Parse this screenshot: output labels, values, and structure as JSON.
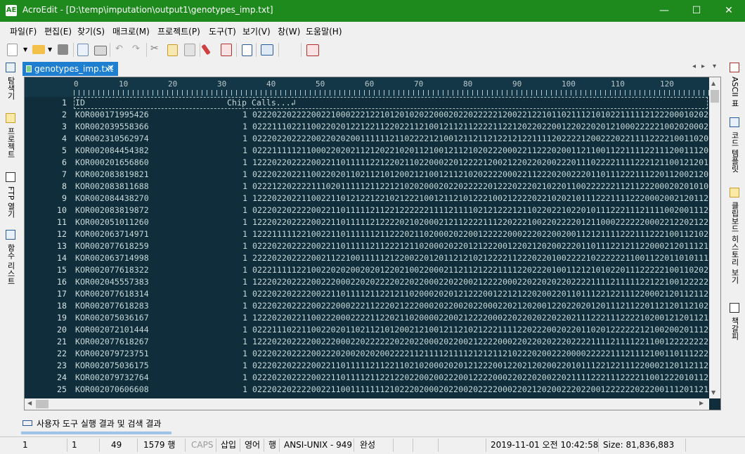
{
  "window": {
    "app_icon": "AE",
    "title": "AcroEdit - [D:\\temp\\imputation\\output1\\genotypes_imp.txt]",
    "minimize": "—",
    "maximize": "☐",
    "close": "✕"
  },
  "menu": [
    "파일(F)",
    "편집(E)",
    "찾기(S)",
    "매크로(M)",
    "프로젝트(P)",
    "도구(T)",
    "보기(V)",
    "창(W)",
    "도움말(H)"
  ],
  "left_panels": [
    {
      "label": "탐색기",
      "icon": "explorer-icon"
    },
    {
      "label": "프로젝트",
      "icon": "project-icon"
    },
    {
      "label": "FTP 열기",
      "icon": "ftp-icon"
    },
    {
      "label": "함수 리스트",
      "icon": "function-list-icon"
    }
  ],
  "right_panels": [
    {
      "label": "ASCII 표",
      "icon": "ascii-table-icon"
    },
    {
      "label": "코드 템플릿",
      "icon": "code-template-icon"
    },
    {
      "label": "클립보드 히스토리 보기",
      "icon": "clipboard-history-icon"
    },
    {
      "label": "책갈피",
      "icon": "bookmark-icon"
    }
  ],
  "tab": {
    "name": "genotypes_imp.txt",
    "close": "✕"
  },
  "tab_nav": {
    "prev": "◂",
    "next": "▸",
    "menu": "▾"
  },
  "ruler": [
    "0",
    "10",
    "20",
    "30",
    "40",
    "50",
    "60",
    "70",
    "80",
    "90",
    "100",
    "110",
    "120"
  ],
  "lines": [
    {
      "n": "1",
      "id": "ID",
      "chip": "Chip Calls...↲",
      "calls": ""
    },
    {
      "n": "2",
      "id": "KOR000171995426",
      "chip": "1",
      "calls": "0222022022220022100022212210120102022000202202222212002212210110211121010221111121222000102020"
    },
    {
      "n": "3",
      "id": "KOR002039558366",
      "chip": "1",
      "calls": "0222111022110022020122122112202211210012112112222112212022022001220220201210002222210020200022"
    },
    {
      "n": "4",
      "id": "KOR002310562974",
      "chip": "1",
      "calls": "0222022022220022020200111111211022221210012112112122121221111202222120022202211112222100110201"
    },
    {
      "n": "5",
      "id": "KOR002084454382",
      "chip": "1",
      "calls": "0222111112110002202021121202210201121001211210202220002211222020011211001122111122111200111202"
    },
    {
      "n": "6",
      "id": "KOR000201656860",
      "chip": "1",
      "calls": "1222022022220022110111112212202110220002201222212002122022020022201110222211112221211001212011"
    },
    {
      "n": "7",
      "id": "KOR002083819821",
      "chip": "1",
      "calls": "0222022022110022020110211210120021210012112102022220002211222020022201101112221112201120021201"
    },
    {
      "n": "8",
      "id": "KOR002083811688",
      "chip": "1",
      "calls": "0222122022221110201111121122121020200020220222220122202220210220110022222211211222000202010102"
    },
    {
      "n": "9",
      "id": "KOR002084438270",
      "chip": "1",
      "calls": "1222022022110022110121221221021222100121121012221002122220221020210111222111122200020021201121"
    },
    {
      "n": "10",
      "id": "KOR002083819872",
      "chip": "1",
      "calls": "0222022022220022110111112112212222221111211110212122212110220221022010111222111211110020011120"
    },
    {
      "n": "11",
      "id": "KOR002051011260",
      "chip": "1",
      "calls": "1222022022220022110111112122220210200021211222211122022210022022220121100022222200022122021222"
    },
    {
      "n": "12",
      "id": "KOR002063714971",
      "chip": "1",
      "calls": "1222111112210022110111111211222021102000202200122222000222022002001121211112221112221001121022"
    },
    {
      "n": "13",
      "id": "KOR002077618259",
      "chip": "1",
      "calls": "0222022022220022110111112112221211020002022012122200122021202002220110111221211220002120111211"
    },
    {
      "n": "14",
      "id": "KOR002063714998",
      "chip": "1",
      "calls": "2222022022220021122100111112122002201201121210212222112220220100222210222222110011220110101112"
    },
    {
      "n": "15",
      "id": "KOR002077618322",
      "chip": "1",
      "calls": "0222111112210022020200202012202100220002112112122211112202220100112121010220111222221001102022"
    },
    {
      "n": "16",
      "id": "KOR002045557383",
      "chip": "1",
      "calls": "1222022022220022200022020222202202200022022002122220002202202022022221111211111221221001222222"
    },
    {
      "n": "17",
      "id": "KOR002077618314",
      "chip": "1",
      "calls": "0222022022220022110111121122121102000202012122200122121220200220110111221221112200021201121122"
    },
    {
      "n": "18",
      "id": "KOR002077618283",
      "chip": "1",
      "calls": "0222022022220022200022211222021222000202200202200022021202001220220201201112112201121201121022"
    },
    {
      "n": "19",
      "id": "KOR002075036167",
      "chip": "1",
      "calls": "1222022022110022200022221122021102000022002122220002202202022022021112221112222102001212011211"
    },
    {
      "n": "20",
      "id": "KOR002072101444",
      "chip": "1",
      "calls": "0222111022110022020110211210120021210012112102122211112202220020220110201222222121002002011120"
    },
    {
      "n": "21",
      "id": "KOR002077618267",
      "chip": "1",
      "calls": "1222022022220022200022022222202202200020220021222200022022020222022221111211112211001222222222"
    },
    {
      "n": "22",
      "id": "KOR002079723751",
      "chip": "1",
      "calls": "0222022022220022202002020200222211211112111121212112102220200222000022222111211121001101112222"
    },
    {
      "n": "23",
      "id": "KOR002075036175",
      "chip": "1",
      "calls": "0222022022220022110111112112211021020002020121222001220212020022010111221221112200021201121122"
    },
    {
      "n": "24",
      "id": "KOR002079732764",
      "chip": "1",
      "calls": "0222022022220022110111121122122022002002220012222000220220200220211112221112222110012220101122"
    },
    {
      "n": "25",
      "id": "KOR002070606608",
      "chip": "1",
      "calls": "0222022022220022110011111112102220200020220020222200022021202002220220012222220222001112011211"
    }
  ],
  "output_panel": {
    "label": "사용자 도구 실행 결과 및 검색 결과"
  },
  "status": {
    "line": "1",
    "col": "1",
    "chars": "49",
    "total_lines": "1579 행",
    "caps": "CAPS",
    "insert": "삽입",
    "lang": "영어",
    "unit": "행",
    "encoding": "ANSI-UNIX - 949",
    "complete": "완성",
    "datetime": "2019-11-01 오전 10:42:58",
    "size": "Size: 81,836,883"
  }
}
